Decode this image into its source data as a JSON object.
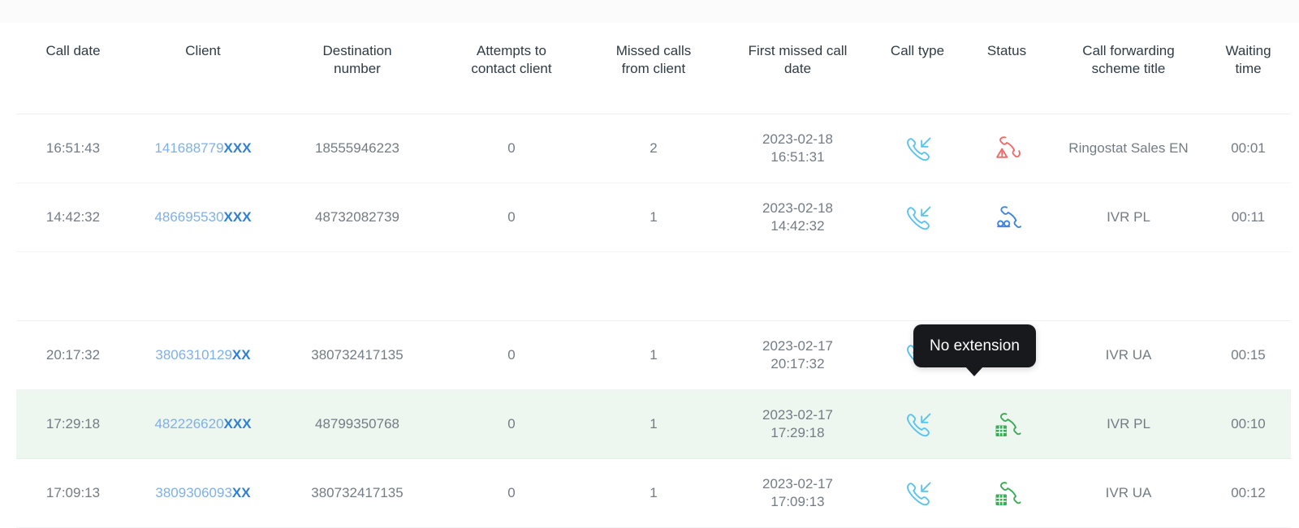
{
  "table": {
    "columns": [
      {
        "key": "call_date",
        "label": "Call date"
      },
      {
        "key": "client",
        "label": "Client"
      },
      {
        "key": "destination_number",
        "label": "Destination\nnumber"
      },
      {
        "key": "attempts",
        "label": "Attempts to\ncontact client"
      },
      {
        "key": "missed_calls",
        "label": "Missed calls\nfrom client"
      },
      {
        "key": "first_missed_call_date",
        "label": "First missed call\ndate"
      },
      {
        "key": "call_type",
        "label": "Call type"
      },
      {
        "key": "status",
        "label": "Status"
      },
      {
        "key": "scheme_title",
        "label": "Call forwarding\nscheme title"
      },
      {
        "key": "waiting_time",
        "label": "Waiting\ntime"
      }
    ],
    "headers": {
      "call_date": "Call date",
      "client": "Client",
      "destination_number_l1": "Destination",
      "destination_number_l2": "number",
      "attempts_l1": "Attempts to",
      "attempts_l2": "contact client",
      "missed_l1": "Missed calls",
      "missed_l2": "from client",
      "first_missed_l1": "First missed call",
      "first_missed_l2": "date",
      "call_type": "Call type",
      "status": "Status",
      "scheme_l1": "Call forwarding",
      "scheme_l2": "scheme title",
      "waiting_l1": "Waiting",
      "waiting_l2": "time"
    },
    "rows": [
      {
        "call_date": "16:51:43",
        "client_number": "141688779",
        "client_mask": "XXX",
        "destination_number": "18555946223",
        "attempts": "0",
        "missed_calls": "2",
        "first_missed_date": "2023-02-18",
        "first_missed_time": "16:51:31",
        "call_type_icon": "incoming-call-icon",
        "status_icon": "missed-call-warning-icon",
        "status_color": "#ef6a6a",
        "scheme_title": "Ringostat Sales EN",
        "waiting_time": "00:01",
        "highlighted": false,
        "spacer": false
      },
      {
        "call_date": "14:42:32",
        "client_number": "486695530",
        "client_mask": "XXX",
        "destination_number": "48732082739",
        "attempts": "0",
        "missed_calls": "1",
        "first_missed_date": "2023-02-18",
        "first_missed_time": "14:42:32",
        "call_type_icon": "incoming-call-icon",
        "status_icon": "voicemail-call-icon",
        "status_color": "#3d85e0",
        "scheme_title": "IVR PL",
        "waiting_time": "00:11",
        "highlighted": false,
        "spacer": false
      },
      {
        "spacer": true
      },
      {
        "call_date": "20:17:32",
        "client_number": "3806310129",
        "client_mask": "XX",
        "destination_number": "380732417135",
        "attempts": "0",
        "missed_calls": "1",
        "first_missed_date": "2023-02-17",
        "first_missed_time": "20:17:32",
        "call_type_icon": "incoming-call-icon",
        "status_icon": "answered-call-icon",
        "status_color": "#3d85e0",
        "scheme_title": "IVR UA",
        "waiting_time": "00:15",
        "highlighted": false,
        "spacer": false
      },
      {
        "call_date": "17:29:18",
        "client_number": "482226620",
        "client_mask": "XXX",
        "destination_number": "48799350768",
        "attempts": "0",
        "missed_calls": "1",
        "first_missed_date": "2023-02-17",
        "first_missed_time": "17:29:18",
        "call_type_icon": "incoming-call-icon",
        "status_icon": "keypad-call-icon",
        "status_color": "#3cab55",
        "scheme_title": "IVR PL",
        "waiting_time": "00:10",
        "highlighted": true,
        "spacer": false
      },
      {
        "call_date": "17:09:13",
        "client_number": "3809306093",
        "client_mask": "XX",
        "destination_number": "380732417135",
        "attempts": "0",
        "missed_calls": "1",
        "first_missed_date": "2023-02-17",
        "first_missed_time": "17:09:13",
        "call_type_icon": "incoming-call-icon",
        "status_icon": "keypad-call-icon",
        "status_color": "#3cab55",
        "scheme_title": "IVR UA",
        "waiting_time": "00:12",
        "highlighted": false,
        "spacer": false
      }
    ]
  },
  "tooltip": {
    "text": "No extension"
  },
  "colors": {
    "call_type_icon": "#5bc3ef",
    "client_link": "#7fb0e8",
    "client_mask": "#2f7fd4",
    "row_highlight_bg": "#eef7ef",
    "text": "#737c85",
    "header_text": "#2f3b45"
  }
}
